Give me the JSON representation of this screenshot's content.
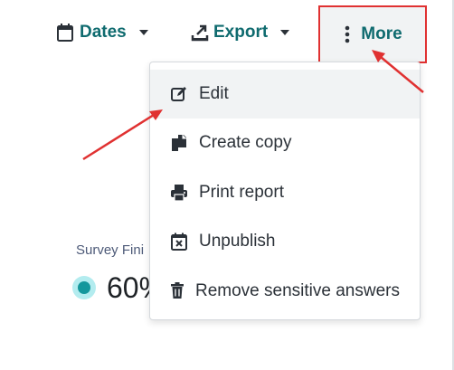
{
  "toolbar": {
    "dates_label": "Dates",
    "export_label": "Export",
    "more_label": "More"
  },
  "background": {
    "survey_label": "Survey Fini",
    "percent_value": "60%"
  },
  "menu": {
    "items": [
      {
        "label": "Edit",
        "icon": "edit-icon"
      },
      {
        "label": "Create copy",
        "icon": "copy-icon"
      },
      {
        "label": "Print report",
        "icon": "print-icon"
      },
      {
        "label": "Unpublish",
        "icon": "calendar-x-icon"
      },
      {
        "label": "Remove sensitive answers",
        "icon": "trash-icon"
      }
    ]
  },
  "colors": {
    "accent": "#0f6b6f",
    "highlight_border": "#e03131",
    "annotation_arrow": "#e03131",
    "dot": "#14979c"
  }
}
